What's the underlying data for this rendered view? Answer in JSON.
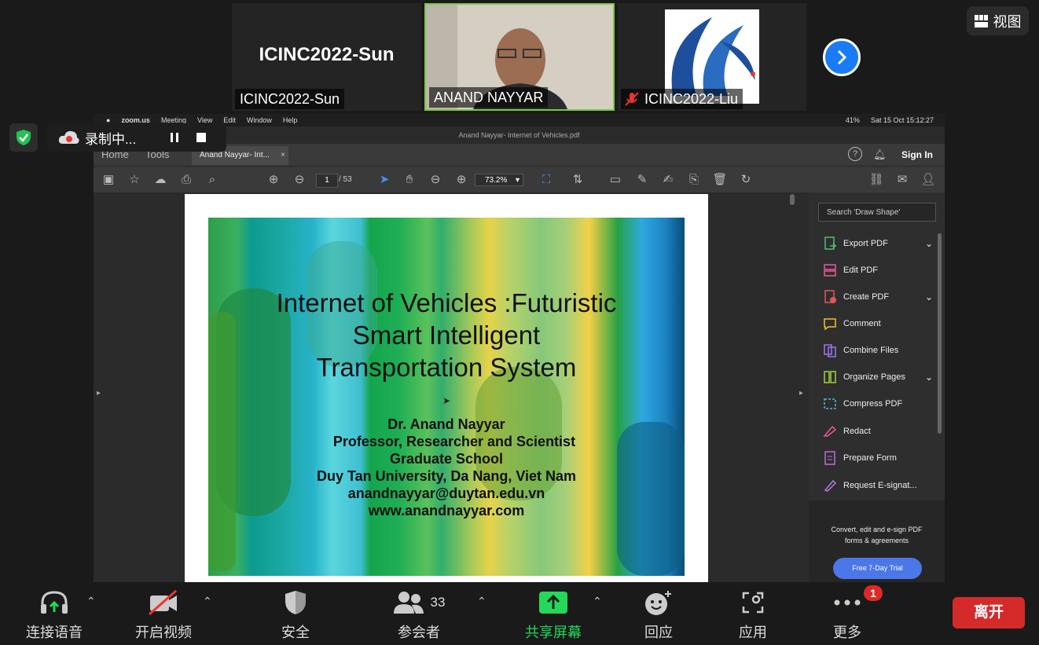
{
  "participants": [
    {
      "name": "ICINC2022-Sun",
      "display_text": "ICINC2022-Sun"
    },
    {
      "name": "ANAND NAYYAR"
    },
    {
      "name": "ICINC2022-Liu"
    }
  ],
  "view_button": "视图",
  "recording": {
    "label": "录制中..."
  },
  "mac_menu": {
    "app": "zoom.us",
    "items": [
      "Meeting",
      "View",
      "Edit",
      "Window",
      "Help"
    ],
    "battery": "41%",
    "datetime": "Sat 15 Oct  15:12:27"
  },
  "acrobat": {
    "window_title": "Anand Nayyar- Internet of Vehicles.pdf",
    "tab_home": "Home",
    "tab_tools": "Tools",
    "doc_tab": "Anand Nayyar- Int...",
    "sign_in": "Sign In",
    "page_current": "1",
    "page_total": "/  53",
    "zoom": "73.2%",
    "search_placeholder": "Search 'Draw Shape'",
    "tools": [
      "Export PDF",
      "Edit PDF",
      "Create PDF",
      "Comment",
      "Combine Files",
      "Organize Pages",
      "Compress PDF",
      "Redact",
      "Prepare Form",
      "Request E-signat..."
    ],
    "promo_text": "Convert, edit and e-sign PDF forms & agreements",
    "trial_button": "Free 7-Day Trial"
  },
  "slide": {
    "title_lines": [
      "Internet of Vehicles :Futuristic",
      "Smart Intelligent",
      "Transportation System"
    ],
    "author": "Dr. Anand Nayyar",
    "role": "Professor, Researcher and Scientist",
    "school": "Graduate School",
    "university": "Duy Tan University, Da Nang, Viet Nam",
    "email": "anandnayyar@duytan.edu.vn",
    "website": "www.anandnayyar.com"
  },
  "toolbar": {
    "audio": "连接语音",
    "video": "开启视频",
    "security": "安全",
    "participants": "参会者",
    "participant_count": "33",
    "share": "共享屏幕",
    "reactions": "回应",
    "apps": "应用",
    "more": "更多",
    "more_badge": "1",
    "leave": "离开"
  },
  "colors": {
    "share_green": "#23d959",
    "leave_red": "#d42a2a",
    "active_speaker": "#7ac943",
    "accent_blue": "#1a7bf5"
  }
}
